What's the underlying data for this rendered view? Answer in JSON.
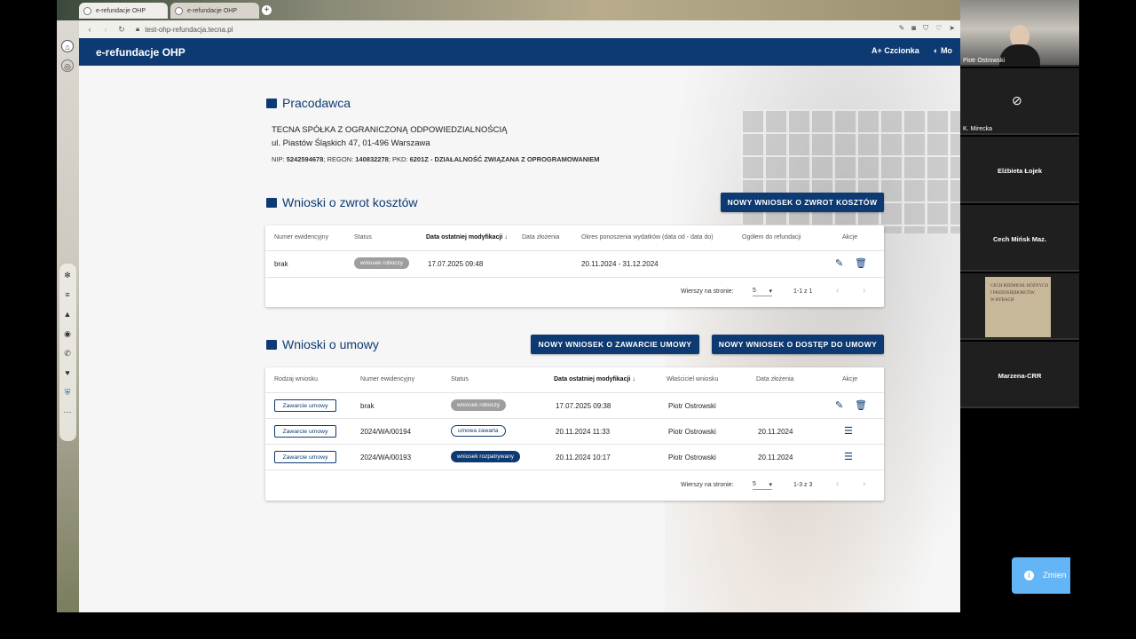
{
  "browser": {
    "tabs": [
      {
        "label": "e-refundacje OHP"
      },
      {
        "label": "e-refundacje OHP"
      }
    ],
    "url": "test-ohp-refundacja.tecna.pl"
  },
  "app": {
    "title": "e-refundacje OHP",
    "font_label": "A+ Czcionka",
    "mode_label": "Mo"
  },
  "employer": {
    "section_title": "Pracodawca",
    "name": "TECNA SPÓŁKA Z OGRANICZONĄ ODPOWIEDZIALNOŚCIĄ",
    "address": "ul. Piastów Śląskich 47, 01-496 Warszawa",
    "nip_label": "NIP:",
    "nip": "5242594678",
    "regon_label": "; REGON:",
    "regon": "140832278",
    "pkd_label": "; PKD:",
    "pkd": "6201Z - DZIAŁALNOŚĆ ZWIĄZANA Z OPROGRAMOWANIEM"
  },
  "refunds": {
    "section_title": "Wnioski o zwrot kosztów",
    "new_button": "NOWY WNIOSEK O ZWROT KOSZTÓW",
    "columns": [
      "Numer ewidencyjny",
      "Status",
      "Data ostatniej modyfikacji",
      "Data złożenia",
      "Okres ponoszenia wydatków (data od - data do)",
      "Ogółem do refundacji",
      "Akcje"
    ],
    "rows": [
      {
        "number": "brak",
        "status": "wniosek roboczy",
        "modified": "17.07.2025  09:48",
        "submitted": "",
        "period": "20.11.2024 - 31.12.2024",
        "total": ""
      }
    ],
    "rows_per_page_label": "Wierszy na stronie:",
    "rows_per_page": "5",
    "range": "1-1 z 1"
  },
  "agreements": {
    "section_title": "Wnioski o umowy",
    "new_agreement_button": "NOWY WNIOSEK O ZAWARCIE UMOWY",
    "new_access_button": "NOWY WNIOSEK O DOSTĘP DO UMOWY",
    "columns": [
      "Rodzaj wniosku",
      "Numer ewidencyjny",
      "Status",
      "Data ostatniej modyfikacji",
      "Właściciel wniosku",
      "Data złożenia",
      "Akcje"
    ],
    "rows": [
      {
        "type": "Zawarcie umowy",
        "number": "brak",
        "status": "wniosek roboczy",
        "modified": "17.07.2025  09:38",
        "owner": "Piotr Ostrowski",
        "submitted": ""
      },
      {
        "type": "Zawarcie umowy",
        "number": "2024/WA/00194",
        "status": "umowa zawarta",
        "modified": "20.11.2024  11:33",
        "owner": "Piotr Ostrowski",
        "submitted": "20.11.2024"
      },
      {
        "type": "Zawarcie umowy",
        "number": "2024/WA/00193",
        "status": "wniosek rozpatrywany",
        "modified": "20.11.2024  10:17",
        "owner": "Piotr Ostrowski",
        "submitted": "20.11.2024"
      }
    ],
    "rows_per_page_label": "Wierszy na stronie:",
    "rows_per_page": "5",
    "range": "1-3 z 3"
  },
  "toast": {
    "text": "Zmien"
  },
  "meeting": {
    "participants": [
      "Piotr Ostrowski",
      "K. Mirecka",
      "Elżbieta Łojek",
      "Cech Mińsk Maz.",
      "",
      "Marzena-CRR"
    ],
    "tile5_image_text": [
      "CECH RZEMIOSŁ RÓŻNYCH",
      "I PRZEDSIĘBIORCÓW",
      "W RYBACH"
    ]
  },
  "colors": {
    "primary": "#0d3a72",
    "badge_grey": "#9e9e9e",
    "toast": "#64b5f6"
  }
}
